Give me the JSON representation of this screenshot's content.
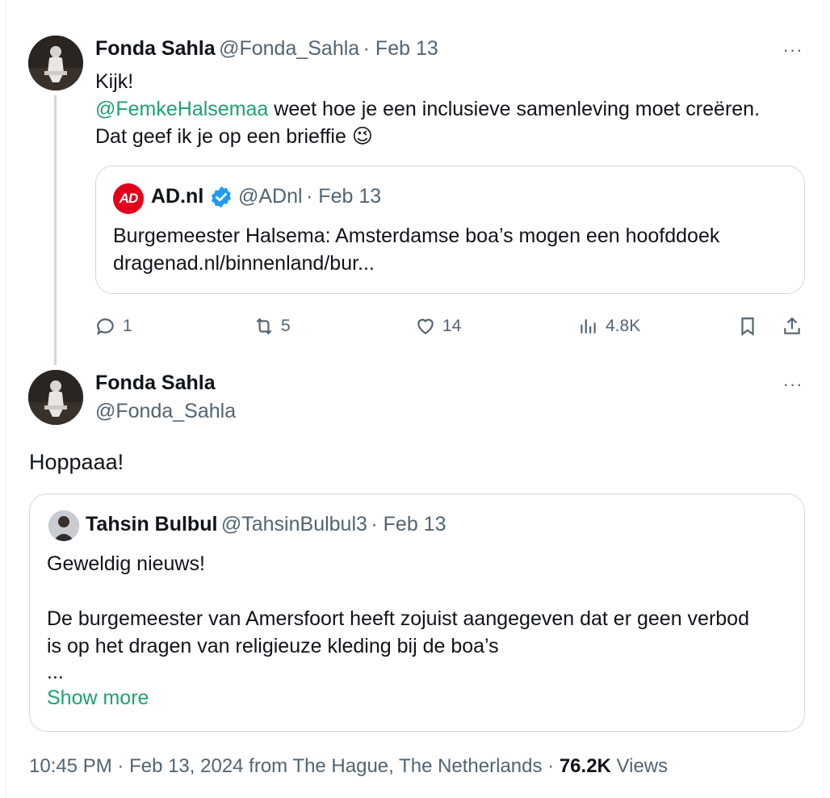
{
  "tweet1": {
    "author_name": "Fonda Sahla",
    "author_handle": "@Fonda_Sahla",
    "date": "· Feb 13",
    "more": "···",
    "line1": "Kijk!",
    "mention": "@FemkeHalsemaa",
    "line2_rest": " weet hoe je een inclusieve samenleving moet creëren.",
    "line3": "Dat geef ik je op een brieffie",
    "emoji": "😉",
    "quote": {
      "logo_text": "AD",
      "name": "AD.nl",
      "handle": "@ADnl",
      "date": "· Feb 13",
      "line1": "Burgemeester Halsema: Amsterdamse boa’s mogen een hoofddoek",
      "line2": "dragenad.nl/binnenland/bur..."
    },
    "actions": {
      "replies": "1",
      "reposts": "5",
      "likes": "14",
      "views": "4.8K"
    }
  },
  "tweet2": {
    "author_name": "Fonda Sahla",
    "author_handle": "@Fonda_Sahla",
    "more": "···",
    "text": "Hoppaaa!",
    "quote": {
      "name": "Tahsin Bulbul",
      "handle": "@TahsinBulbul3",
      "date": "· Feb 13",
      "line1": "Geweldig nieuws!",
      "line2": "De burgemeester van Amersfoort heeft zojuist aangegeven dat er geen verbod",
      "line3": "is op het dragen van religieuze kleding bij de boa’s",
      "ellipsis": "...",
      "show_more": "Show more"
    },
    "footer": {
      "time": "10:45 PM",
      "date_place": " · Feb 13, 2024 from The Hague, The Netherlands · ",
      "views_count": "76.2K",
      "views_label": " Views"
    }
  },
  "colors": {
    "link": "#1da271",
    "secondary_text": "#536471",
    "border": "#cfd9de",
    "verified": "#1d9bf0",
    "ad_red": "#e2001a"
  }
}
